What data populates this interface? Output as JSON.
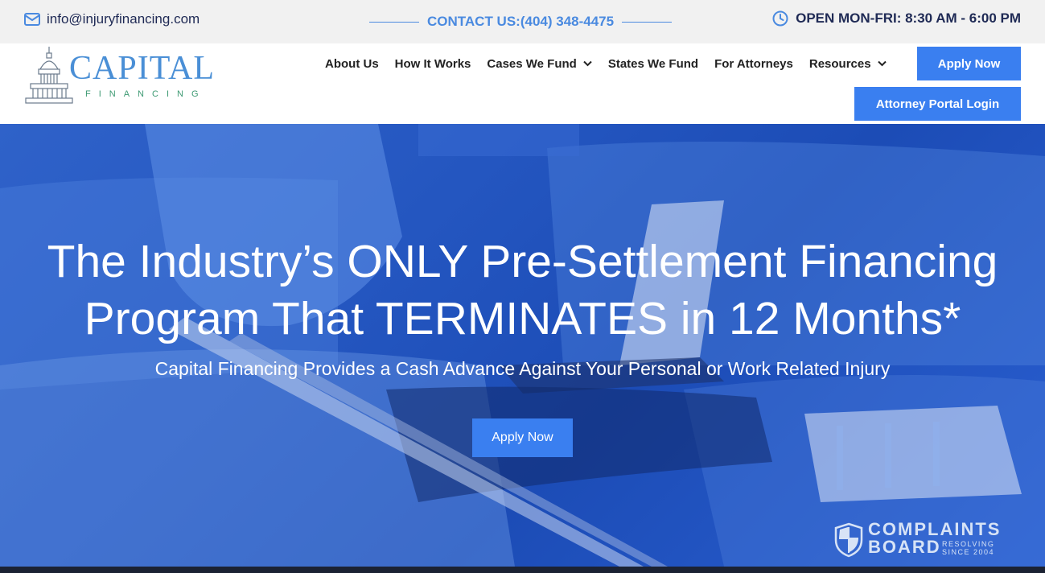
{
  "topbar": {
    "email": "info@injuryfinancing.com",
    "contact": "CONTACT US:(404) 348-4475",
    "hours": "OPEN MON-FRI: 8:30 AM - 6:00 PM",
    "icons": {
      "email": "envelope-icon",
      "hours": "clock-icon"
    }
  },
  "logo": {
    "name": "CAPITAL",
    "sub": "FINANCING"
  },
  "nav": {
    "items": [
      {
        "label": "About Us",
        "dropdown": false
      },
      {
        "label": "How It Works",
        "dropdown": false
      },
      {
        "label": "Cases We Fund",
        "dropdown": true
      },
      {
        "label": "States We Fund",
        "dropdown": false
      },
      {
        "label": "For Attorneys",
        "dropdown": false
      },
      {
        "label": "Resources",
        "dropdown": true
      }
    ],
    "apply_label": "Apply Now",
    "portal_label": "Attorney Portal Login"
  },
  "hero": {
    "title_line1": "The Industry’s ONLY Pre-Settlement Financing",
    "title_line2": "Program That TERMINATES in 12 Months*",
    "subtitle": "Capital Financing Provides a Cash Advance Against Your Personal or Work Related Injury",
    "cta_label": "Apply Now"
  },
  "badge": {
    "line1": "COMPLAINTS",
    "line2": "BOARD",
    "tag1": "RESOLVING",
    "tag2": "SINCE 2004"
  },
  "colors": {
    "accent": "#3a7ff0",
    "topbar_bg": "#f1f1f1",
    "navy_text": "#1f2a55",
    "contact_blue": "#4a8ae0",
    "logo_blue": "#4a8fd6",
    "logo_green": "#3e9a73",
    "hero_overlay": "#2456c0"
  }
}
